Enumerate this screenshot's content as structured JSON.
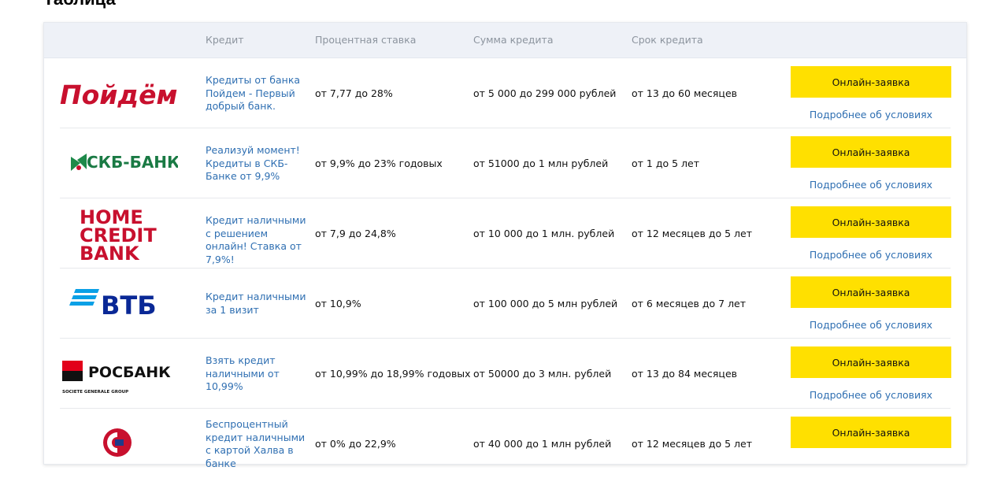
{
  "page": {
    "title": "Таблица"
  },
  "table": {
    "headers": {
      "credit": "Кредит",
      "rate": "Процентная ставка",
      "amount": "Сумма кредита",
      "term": "Срок кредита"
    },
    "apply_label": "Онлайн-заявка",
    "details_label": "Подробнее об условиях",
    "rows": [
      {
        "bank_logo": "pochta-poidem-logo",
        "logo_text": "Пойдём!",
        "credit_title": "Кредиты от банка Пойдем - Первый добрый банк.",
        "rate": "от 7,77 до 28%",
        "amount": "от 5 000 до 299 000 рублей",
        "term": "от 13 до 60 месяцев"
      },
      {
        "bank_logo": "skb-bank-logo",
        "logo_text": "СКБ-БАНК",
        "credit_title": "Реализуй момент! Кредиты в СКБ-Банке от 9,9%",
        "rate": "от 9,9% до 23% годовых",
        "amount": "от 51000 до 1 млн рублей",
        "term": "от 1 до 5 лет"
      },
      {
        "bank_logo": "home-credit-bank-logo",
        "logo_line1": "HOME",
        "logo_line2": "CREDIT",
        "logo_line3": "BANK",
        "credit_title": "Кредит наличными с решением онлайн! Ставка от 7,9%!",
        "rate": "от 7,9 до 24,8%",
        "amount": "от 10 000 до 1 млн. рублей",
        "term": "от 12 месяцев до 5 лет"
      },
      {
        "bank_logo": "vtb-logo",
        "logo_text": "ВТБ",
        "credit_title": "Кредит наличными за 1 визит",
        "rate": "от 10,9%",
        "amount": "от 100 000 до 5 млн рублей",
        "term": "от 6 месяцев до 7 лет"
      },
      {
        "bank_logo": "rosbank-logo",
        "logo_text": "РОСБАНК",
        "logo_subtext": "SOCIETE GENERALE GROUP",
        "credit_title": "Взять кредит наличными от 10,99%",
        "rate": "от 10,99% до 18,99% годовых",
        "amount": "от 50000 до 3 млн. рублей",
        "term": "от 13 до 84 месяцев"
      },
      {
        "bank_logo": "sovcombank-logo",
        "credit_title": "Беспроцентный кредит наличными с картой Халва в банке",
        "rate": "от 0% до 22,9%",
        "amount": "от 40 000 до 1 млн рублей",
        "term": "от 12 месяцев до 5 лет"
      }
    ]
  },
  "colors": {
    "accent_yellow": "#ffe000",
    "link_blue": "#2f6fb2",
    "header_bg": "#eef1f7"
  }
}
